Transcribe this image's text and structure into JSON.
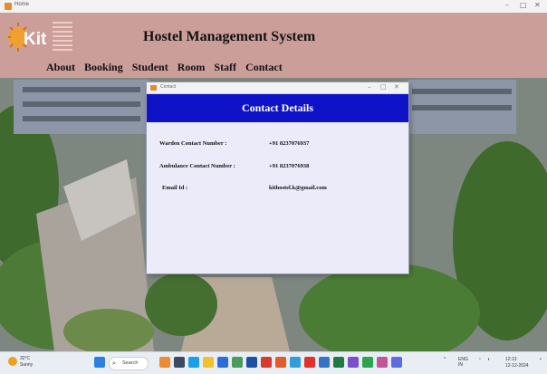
{
  "window": {
    "title": "Home",
    "controls": [
      "–",
      "□",
      "✕"
    ]
  },
  "app": {
    "title": "Hostel Management System",
    "nav": [
      "About",
      "Booking",
      "Student",
      "Room",
      "Staff",
      "Contact"
    ],
    "logo_letters": "Kit"
  },
  "dialog": {
    "window_title": "Contact",
    "heading": "Contact Details",
    "rows": [
      {
        "label": "Warden Contact Number :",
        "value": "+91 8237076937"
      },
      {
        "label": "Ambulance Contact Number :",
        "value": "+91 8237076938"
      },
      {
        "label": "Email Id :",
        "value": "kithostel.k@gmail.com"
      }
    ]
  },
  "taskbar": {
    "weather_temp": "32°C",
    "weather_text": "Sunny",
    "search_label": "Search",
    "tray_lang": "ENG IN",
    "time": "12:13",
    "date": "12-12-2024"
  }
}
